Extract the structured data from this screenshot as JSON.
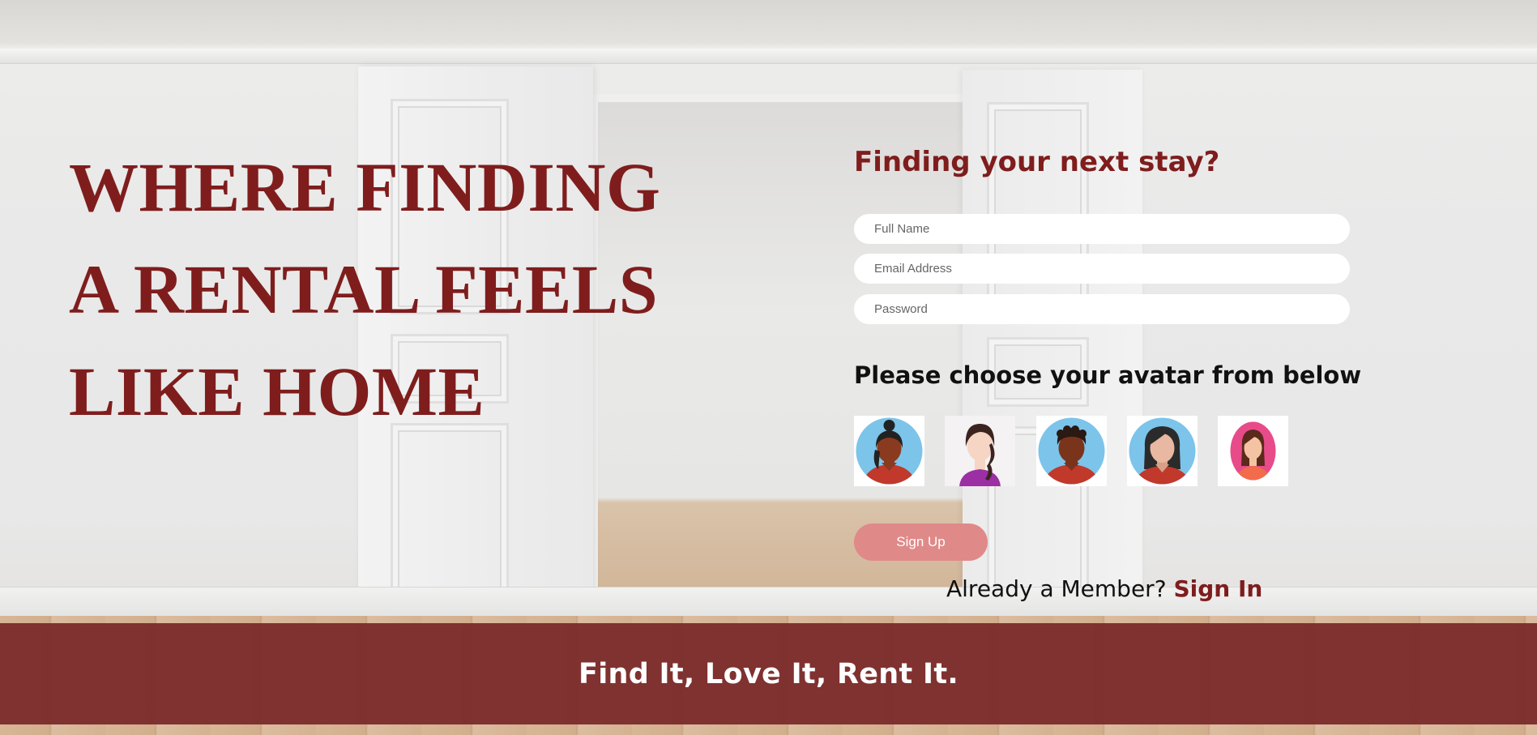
{
  "hero": {
    "headline_lines": [
      "WHERE FINDING",
      "A RENTAL FEELS",
      "LIKE HOME"
    ]
  },
  "form": {
    "title": "Finding your next stay?",
    "fields": {
      "full_name": {
        "placeholder": "Full Name",
        "value": ""
      },
      "email": {
        "placeholder": "Email Address",
        "value": ""
      },
      "password": {
        "placeholder": "Password",
        "value": ""
      }
    },
    "avatar_prompt": "Please choose your avatar from below",
    "avatars": [
      {
        "name": "avatar-woman-dark-bun-icon"
      },
      {
        "name": "avatar-woman-braid-icon"
      },
      {
        "name": "avatar-man-curly-icon"
      },
      {
        "name": "avatar-woman-long-hair-icon"
      },
      {
        "name": "avatar-woman-pink-icon"
      }
    ],
    "signup_label": "Sign Up",
    "member_text": "Already a Member?",
    "signin_label": "Sign In"
  },
  "footer": {
    "tagline": "Find It, Love It, Rent It."
  },
  "colors": {
    "brand": "#7f1d1d",
    "button": "#e08989",
    "footer_band": "#782828",
    "avatar_blue": "#7cc4ea",
    "avatar_pink": "#e84b8a"
  }
}
